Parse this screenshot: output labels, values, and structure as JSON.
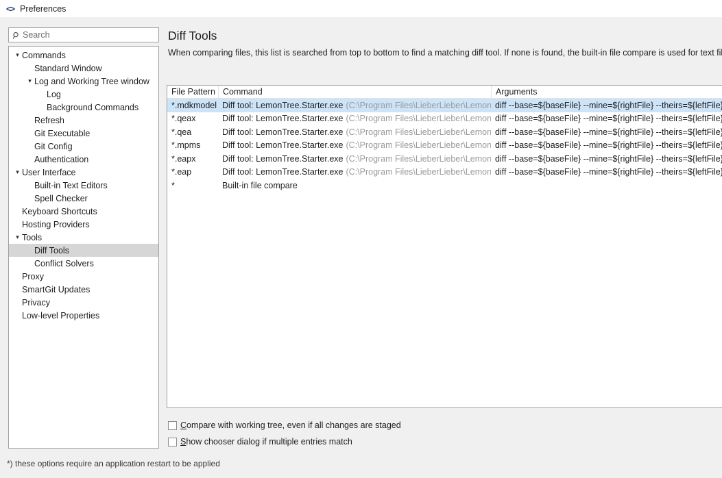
{
  "titlebar": {
    "icon": "code-brackets-icon",
    "icon_glyph": "<>",
    "title": "Preferences"
  },
  "search": {
    "icon": "search-icon",
    "placeholder": "Search",
    "value": ""
  },
  "sidebar": {
    "items": [
      {
        "label": "Commands",
        "indent": 0,
        "chevron": "⌄",
        "expanded": true,
        "selected": false
      },
      {
        "label": "Standard Window",
        "indent": 1,
        "chevron": "",
        "expanded": false,
        "selected": false
      },
      {
        "label": "Log and Working Tree window",
        "indent": 1,
        "chevron": "⌄",
        "expanded": true,
        "selected": false
      },
      {
        "label": "Log",
        "indent": 2,
        "chevron": "",
        "expanded": false,
        "selected": false
      },
      {
        "label": "Background Commands",
        "indent": 2,
        "chevron": "",
        "expanded": false,
        "selected": false
      },
      {
        "label": "Refresh",
        "indent": 1,
        "chevron": "",
        "expanded": false,
        "selected": false
      },
      {
        "label": "Git Executable",
        "indent": 1,
        "chevron": "",
        "expanded": false,
        "selected": false
      },
      {
        "label": "Git Config",
        "indent": 1,
        "chevron": "",
        "expanded": false,
        "selected": false
      },
      {
        "label": "Authentication",
        "indent": 1,
        "chevron": "",
        "expanded": false,
        "selected": false
      },
      {
        "label": "User Interface",
        "indent": 0,
        "chevron": "⌄",
        "expanded": true,
        "selected": false
      },
      {
        "label": "Built-in Text Editors",
        "indent": 1,
        "chevron": "",
        "expanded": false,
        "selected": false
      },
      {
        "label": "Spell Checker",
        "indent": 1,
        "chevron": "",
        "expanded": false,
        "selected": false
      },
      {
        "label": "Keyboard Shortcuts",
        "indent": 0,
        "chevron": "",
        "expanded": false,
        "selected": false
      },
      {
        "label": "Hosting Providers",
        "indent": 0,
        "chevron": "",
        "expanded": false,
        "selected": false
      },
      {
        "label": "Tools",
        "indent": 0,
        "chevron": "⌄",
        "expanded": true,
        "selected": false
      },
      {
        "label": "Diff Tools",
        "indent": 1,
        "chevron": "",
        "expanded": false,
        "selected": true
      },
      {
        "label": "Conflict Solvers",
        "indent": 1,
        "chevron": "",
        "expanded": false,
        "selected": false
      },
      {
        "label": "Proxy",
        "indent": 0,
        "chevron": "",
        "expanded": false,
        "selected": false
      },
      {
        "label": "SmartGit Updates",
        "indent": 0,
        "chevron": "",
        "expanded": false,
        "selected": false
      },
      {
        "label": "Privacy",
        "indent": 0,
        "chevron": "",
        "expanded": false,
        "selected": false
      },
      {
        "label": "Low-level Properties",
        "indent": 0,
        "chevron": "",
        "expanded": false,
        "selected": false
      }
    ]
  },
  "main": {
    "title": "Diff Tools",
    "description": "When comparing files, this list is searched from top to bottom to find a matching diff tool. If none is found, the built-in file compare is used for text files.",
    "table": {
      "columns": [
        "File Pattern",
        "Command",
        "Arguments"
      ],
      "rows": [
        {
          "file_pattern": "*.mdkmodel",
          "command": "Diff tool: LemonTree.Starter.exe",
          "command_path": "(C:\\Program Files\\LieberLieber\\LemonTree)",
          "arguments": "diff --base=${baseFile} --mine=${rightFile} --theirs=${leftFile}",
          "selected": true
        },
        {
          "file_pattern": "*.qeax",
          "command": "Diff tool: LemonTree.Starter.exe",
          "command_path": "(C:\\Program Files\\LieberLieber\\LemonTree)",
          "arguments": "diff --base=${baseFile} --mine=${rightFile} --theirs=${leftFile}",
          "selected": false
        },
        {
          "file_pattern": "*.qea",
          "command": "Diff tool: LemonTree.Starter.exe",
          "command_path": "(C:\\Program Files\\LieberLieber\\LemonTree)",
          "arguments": "diff --base=${baseFile} --mine=${rightFile} --theirs=${leftFile}",
          "selected": false
        },
        {
          "file_pattern": "*.mpms",
          "command": "Diff tool: LemonTree.Starter.exe",
          "command_path": "(C:\\Program Files\\LieberLieber\\LemonTree)",
          "arguments": "diff --base=${baseFile} --mine=${rightFile} --theirs=${leftFile}",
          "selected": false
        },
        {
          "file_pattern": "*.eapx",
          "command": "Diff tool: LemonTree.Starter.exe",
          "command_path": "(C:\\Program Files\\LieberLieber\\LemonTree)",
          "arguments": "diff --base=${baseFile} --mine=${rightFile} --theirs=${leftFile}",
          "selected": false
        },
        {
          "file_pattern": "*.eap",
          "command": "Diff tool: LemonTree.Starter.exe",
          "command_path": "(C:\\Program Files\\LieberLieber\\LemonTree)",
          "arguments": "diff --base=${baseFile} --mine=${rightFile} --theirs=${leftFile}",
          "selected": false
        },
        {
          "file_pattern": "*",
          "command": "Built-in file compare",
          "command_path": "",
          "arguments": "",
          "selected": false
        }
      ]
    },
    "checkboxes": [
      {
        "mnemonic": "C",
        "label": "ompare with working tree, even if all changes are staged",
        "checked": false
      },
      {
        "mnemonic": "S",
        "label": "how chooser dialog if multiple entries match",
        "checked": false
      }
    ]
  },
  "footer": {
    "note": "*) these options require an application restart to be applied"
  },
  "colors": {
    "selection_row": "#cde3f7",
    "selection_tree": "#d6d6d6",
    "window_bg": "#f0f0f0",
    "panel_bg": "#ffffff",
    "path_text": "#9a9a9a",
    "border": "#a0a0a0",
    "title_icon": "#1b2f6b"
  }
}
